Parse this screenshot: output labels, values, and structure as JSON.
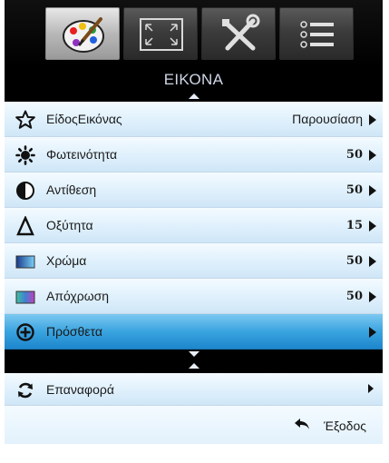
{
  "tabs": [
    {
      "icon": "palette-icon",
      "active": true
    },
    {
      "icon": "fullscreen-icon",
      "active": false
    },
    {
      "icon": "tools-icon",
      "active": false
    },
    {
      "icon": "options-list-icon",
      "active": false
    }
  ],
  "header": {
    "title": "ΕΙΚΟΝΑ"
  },
  "menu": [
    {
      "icon": "star-icon",
      "label": "ΕίδοςΕικόνας",
      "value": "Παρουσίαση"
    },
    {
      "icon": "brightness-icon",
      "label": "Φωτεινότητα",
      "value": "50"
    },
    {
      "icon": "contrast-icon",
      "label": "Αντίθεση",
      "value": "50"
    },
    {
      "icon": "sharpness-icon",
      "label": "Οξύτητα",
      "value": "15"
    },
    {
      "icon": "color-icon",
      "label": "Χρώμα",
      "value": "50"
    },
    {
      "icon": "tint-icon",
      "label": "Απόχρωση",
      "value": "50"
    },
    {
      "icon": "advanced-icon",
      "label": "Πρόσθετα",
      "value": ""
    }
  ],
  "reset": {
    "icon": "reset-icon",
    "label": "Επαναφορά"
  },
  "footer": {
    "exit_label": "Έξοδος"
  },
  "colors": {
    "selected_row": "#3aa4e0",
    "row_bg": "#dff0fc",
    "header_bg": "#000000"
  }
}
